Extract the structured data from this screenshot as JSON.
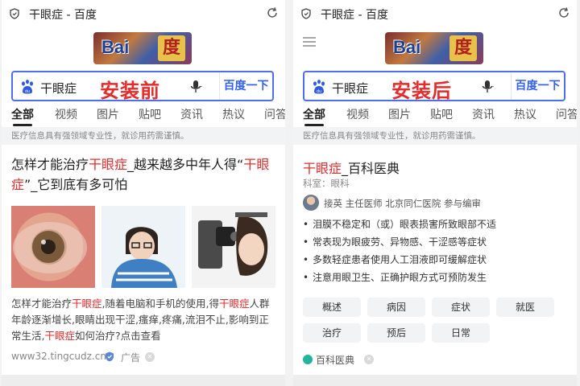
{
  "left": {
    "tab_title": "干眼症 - 百度",
    "query": "干眼症",
    "overlay_label": "安装前",
    "search_button": "百度一下",
    "logo": {
      "text": "Bai",
      "du": "度"
    },
    "nav_tabs": [
      "全部",
      "视频",
      "图片",
      "贴吧",
      "资讯",
      "热议",
      "问答"
    ],
    "notice": "医疗信息具有强领域专业性，就诊用药需谨慎。",
    "result": {
      "title_parts": [
        "怎样才能治疗",
        "干眼症",
        "_越来越多中年人得“",
        "干眼症",
        "”_它到底有多可怕"
      ],
      "summary_parts": [
        "怎样才能治疗",
        "干眼症",
        ",随着电脑和手机的使用,得",
        "干眼症",
        "人群年龄逐渐增长,眼睛出现干涩,瘙痒,疼痛,流泪不止,影响到正常生活,",
        "干眼症",
        "如何治疗?点击查看"
      ],
      "source": "www32.tingcudz.cn",
      "ad": "广告"
    }
  },
  "right": {
    "tab_title": "干眼症 - 百度",
    "query": "干眼症",
    "overlay_label": "安装后",
    "search_button": "百度一下",
    "logo": {
      "text": "Bai",
      "du": "度"
    },
    "nav_tabs": [
      "全部",
      "视频",
      "图片",
      "贴吧",
      "资讯",
      "热议",
      "问答"
    ],
    "notice": "医疗信息具有强领域专业性，就诊用药需谨慎。",
    "baike": {
      "title_hl": "干眼症",
      "title_rest": "_百科医典",
      "dept": "科室：眼科",
      "doctor": "接英 主任医师 北京同仁医院 参与编审",
      "bullets": [
        "泪膜不稳定和（或）眼表损害所致眼部不适",
        "常表现为眼疲劳、异物感、干涩感等症状",
        "多数轻症患者使用人工泪液即可缓解症状",
        "注意用眼卫生、正确护眼方式可预防发生"
      ],
      "chips": [
        "概述",
        "病因",
        "症状",
        "就医",
        "治疗",
        "预后",
        "日常"
      ],
      "source": "百科医典"
    }
  }
}
